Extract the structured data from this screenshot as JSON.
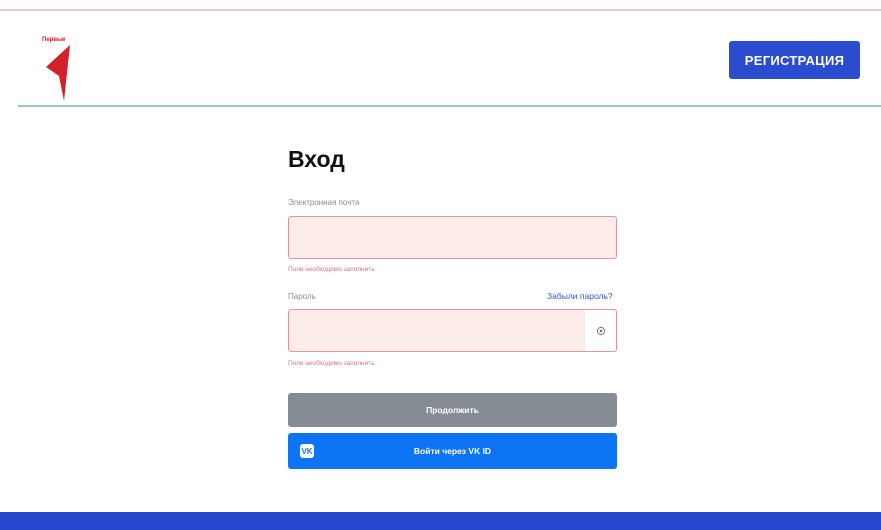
{
  "header": {
    "logo_text": "Первые",
    "register_label": "РЕГИСТРАЦИЯ"
  },
  "form": {
    "title": "Вход",
    "email": {
      "label": "Электронная почта",
      "value": "",
      "error": "Поле необходимо заполнить"
    },
    "password": {
      "label": "Пароль",
      "value": "",
      "error": "Поле необходимо заполнить",
      "forgot_label": "Забыли пароль?"
    },
    "continue_label": "Продолжить",
    "vk_label": "Войти через VK ID"
  },
  "colors": {
    "brand_red": "#d3202b",
    "primary_blue": "#2c4ccf",
    "vk_blue": "#0d74f4",
    "disabled_gray": "#858c94",
    "error_bg": "#fdecea",
    "error_border": "#e6949b"
  },
  "icons": {
    "logo": "brand-arrow-logo-icon",
    "eye": "eye-icon",
    "vk": "vk-logo-icon"
  }
}
